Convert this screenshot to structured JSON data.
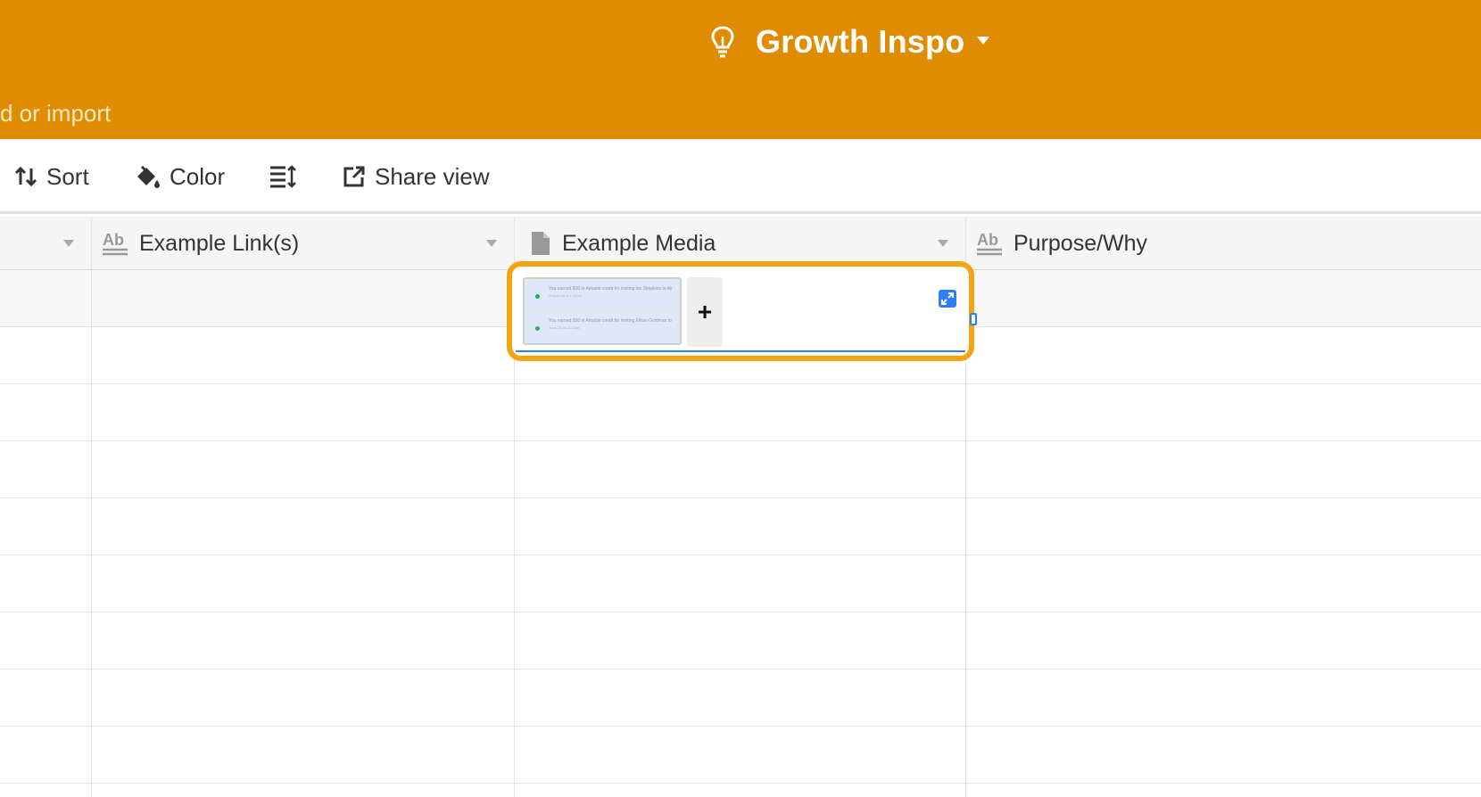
{
  "header": {
    "base_title": "Growth Inspo",
    "add_or_import": "d or import",
    "background_color": "#e08c00"
  },
  "toolbar": {
    "sort_label": "Sort",
    "color_label": "Color",
    "share_view_label": "Share view"
  },
  "grid": {
    "columns": [
      {
        "name": "",
        "type": "primary"
      },
      {
        "name": "Example Link(s)",
        "type": "long-text"
      },
      {
        "name": "Example Media",
        "type": "attachment"
      },
      {
        "name": "Purpose/Why",
        "type": "long-text"
      }
    ],
    "active_cell": {
      "column": "Example Media",
      "attachments": [
        {
          "kind": "screenshot",
          "notifications": [
            {
              "line1": "You earned $10 in Airtable credit for inviting lan Simpkins to Airtable!",
              "line2": "August 18 at 1:15pm"
            },
            {
              "line1": "You earned $10 in Airtable credit for inviting Ethan Goldman to Airtable!",
              "line2": "June 24 at 12:18am"
            }
          ]
        }
      ],
      "add_label": "+"
    },
    "row_count": 9
  },
  "colors": {
    "accent_blue": "#2d7ff9",
    "highlight_orange": "#f2a412"
  }
}
